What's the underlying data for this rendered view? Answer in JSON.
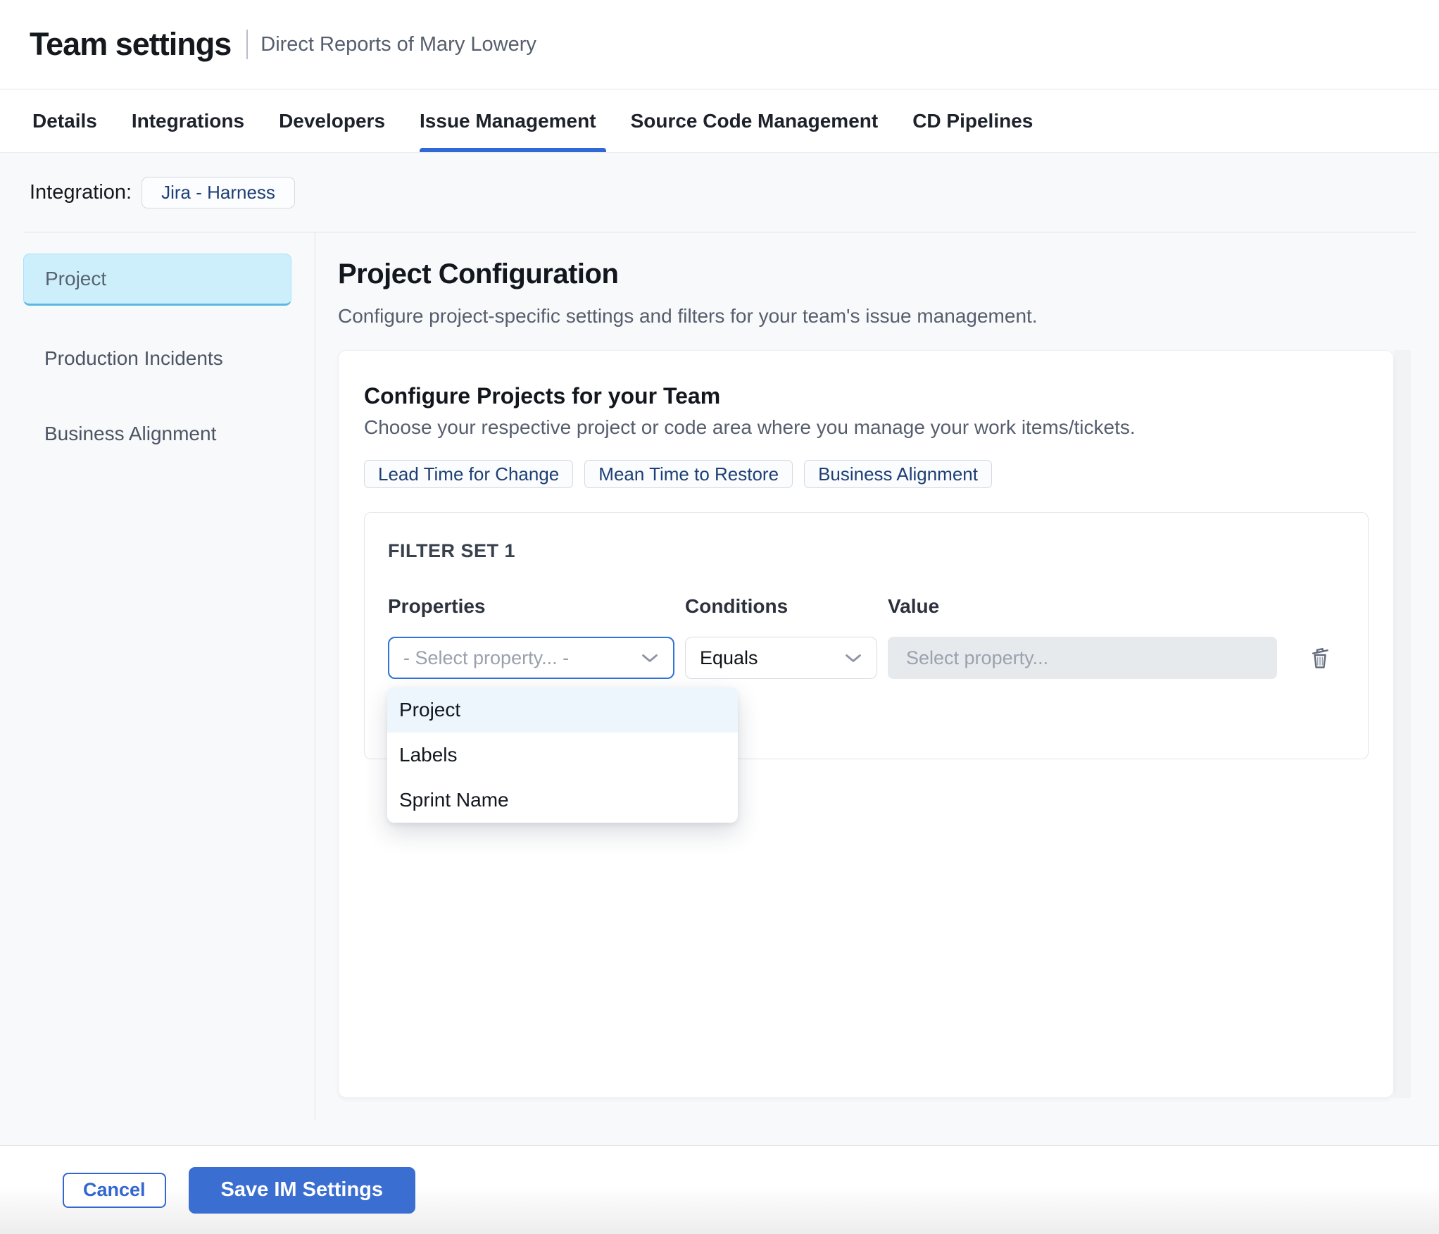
{
  "header": {
    "title": "Team settings",
    "subtitle": "Direct Reports of Mary Lowery"
  },
  "tabs": {
    "items": [
      {
        "label": "Details",
        "active": false
      },
      {
        "label": "Integrations",
        "active": false
      },
      {
        "label": "Developers",
        "active": false
      },
      {
        "label": "Issue Management",
        "active": true
      },
      {
        "label": "Source Code Management",
        "active": false
      },
      {
        "label": "CD Pipelines",
        "active": false
      }
    ]
  },
  "integration": {
    "label": "Integration:",
    "value": "Jira - Harness"
  },
  "sidebar": {
    "items": [
      {
        "label": "Project",
        "selected": true
      },
      {
        "label": "Production Incidents",
        "selected": false
      },
      {
        "label": "Business Alignment",
        "selected": false
      }
    ]
  },
  "main": {
    "title": "Project Configuration",
    "subtitle": "Configure project-specific settings and filters for your team's issue management.",
    "card": {
      "title": "Configure Projects for your Team",
      "subtitle": "Choose your respective project or code area where you manage your work items/tickets.",
      "chips": [
        "Lead Time for Change",
        "Mean Time to Restore",
        "Business Alignment"
      ],
      "filter_set": {
        "title": "FILTER SET 1",
        "columns": [
          "Properties",
          "Conditions",
          "Value"
        ],
        "property_select": {
          "value": "- Select property... -"
        },
        "condition_select": {
          "value": "Equals"
        },
        "value_input": {
          "placeholder": "Select property..."
        },
        "dropdown": {
          "options": [
            {
              "label": "Project",
              "highlighted": true
            },
            {
              "label": "Labels",
              "highlighted": false
            },
            {
              "label": "Sprint Name",
              "highlighted": false
            }
          ]
        },
        "icons": [
          "chevron-down-icon",
          "trash-icon"
        ]
      }
    }
  },
  "footer": {
    "cancel_label": "Cancel",
    "save_label": "Save IM Settings"
  },
  "colors": {
    "accent_blue": "#3168d8",
    "save_button_bg": "#3b6ed1",
    "selected_sidebar_bg": "#cdeffc",
    "selected_sidebar_border": "#5eb7e0",
    "dropdown_highlight_bg": "#ecf6fc",
    "chip_text": "#1d3f75",
    "page_bg": "#f8f9fb",
    "muted_text": "#565e6e",
    "placeholder_text": "#99a1ad",
    "disabled_input_bg": "#e7eaed"
  }
}
